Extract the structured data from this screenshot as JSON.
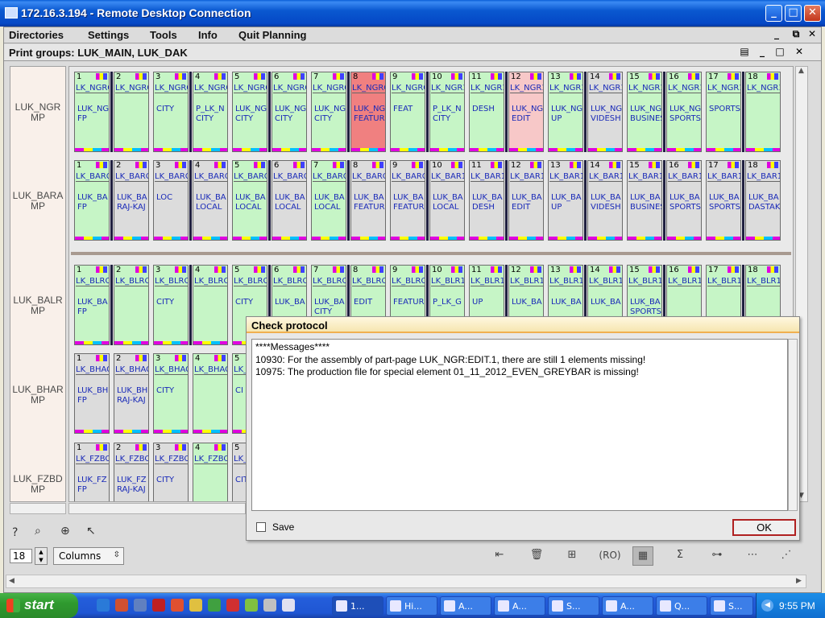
{
  "window": {
    "title": "172.16.3.194 - Remote Desktop Connection",
    "min_label": "_",
    "max_label": "□",
    "close_label": "✕"
  },
  "menu": {
    "items": [
      "Directories",
      "Settings",
      "Tools",
      "Info",
      "Quit Planning"
    ],
    "mdi_min": "_",
    "mdi_restore": "⧉",
    "mdi_close": "✕"
  },
  "print_groups": {
    "label": "Print groups: LUK_MAIN, LUK_DAK",
    "min": "_",
    "restore": "□",
    "close": "✕"
  },
  "row_labels": [
    "LUK_NGR MP",
    "LUK_BARA MP",
    "LUK_BALR MP",
    "LUK_BHAR MP",
    "LUK_FZBD MP"
  ],
  "rows": [
    {
      "prefix": "LK_NGR",
      "pages": [
        {
          "n": "1",
          "nm": "LK_NGRO",
          "sec": "LUK_NG\nFP",
          "c": "green"
        },
        {
          "n": "2",
          "nm": "LK_NGRO",
          "sec": "",
          "c": "green"
        },
        {
          "n": "3",
          "nm": "LK_NGRO",
          "sec": "CITY",
          "c": "green"
        },
        {
          "n": "4",
          "nm": "LK_NGRO",
          "sec": "P_LK_N\nCITY",
          "c": "green"
        },
        {
          "n": "5",
          "nm": "LK_NGRO",
          "sec": "LUK_NG\nCITY",
          "c": "green"
        },
        {
          "n": "6",
          "nm": "LK_NGRO",
          "sec": "LUK_NG\nCITY",
          "c": "green"
        },
        {
          "n": "7",
          "nm": "LK_NGRO",
          "sec": "LUK_NG\nCITY",
          "c": "green"
        },
        {
          "n": "8",
          "nm": "LK_NGRO",
          "sec": "LUK_NG\nFEATUR",
          "c": "red"
        },
        {
          "n": "9",
          "nm": "LK_NGRO",
          "sec": "FEAT",
          "c": "green"
        },
        {
          "n": "10",
          "nm": "LK_NGR1",
          "sec": "P_LK_N\nCITY",
          "c": "green"
        },
        {
          "n": "11",
          "nm": "LK_NGR1",
          "sec": "DESH",
          "c": "green"
        },
        {
          "n": "12",
          "nm": "LK_NGR1",
          "sec": "LUK_NG\nEDIT",
          "c": "pink"
        },
        {
          "n": "13",
          "nm": "LK_NGR1",
          "sec": "LUK_NG\nUP",
          "c": "green"
        },
        {
          "n": "14",
          "nm": "LK_NGR1",
          "sec": "LUK_NG\nVIDESH",
          "c": "grey"
        },
        {
          "n": "15",
          "nm": "LK_NGR1",
          "sec": "LUK_NG\nBUSINES",
          "c": "green"
        },
        {
          "n": "16",
          "nm": "LK_NGR1",
          "sec": "LUK_NG\nSPORTS",
          "c": "green"
        },
        {
          "n": "17",
          "nm": "LK_NGR1",
          "sec": "SPORTS",
          "c": "green"
        },
        {
          "n": "18",
          "nm": "LK_NGR1",
          "sec": "",
          "c": "green"
        }
      ]
    },
    {
      "pages": [
        {
          "n": "1",
          "nm": "LK_BARO",
          "sec": "LUK_BA\nFP",
          "c": "green"
        },
        {
          "n": "2",
          "nm": "LK_BARO",
          "sec": "LUK_BA\nRAJ-KAJ",
          "c": "grey"
        },
        {
          "n": "3",
          "nm": "LK_BARO",
          "sec": "LOC",
          "c": "grey"
        },
        {
          "n": "4",
          "nm": "LK_BARO",
          "sec": "LUK_BA\nLOCAL",
          "c": "grey"
        },
        {
          "n": "5",
          "nm": "LK_BARO",
          "sec": "LUK_BA\nLOCAL",
          "c": "green"
        },
        {
          "n": "6",
          "nm": "LK_BARO",
          "sec": "LUK_BA\nLOCAL",
          "c": "grey"
        },
        {
          "n": "7",
          "nm": "LK_BARO",
          "sec": "LUK_BA\nLOCAL",
          "c": "green"
        },
        {
          "n": "8",
          "nm": "LK_BARO",
          "sec": "LUK_BA\nFEATUR",
          "c": "grey"
        },
        {
          "n": "9",
          "nm": "LK_BARO",
          "sec": "LUK_BA\nFEATUR",
          "c": "grey"
        },
        {
          "n": "10",
          "nm": "LK_BAR1",
          "sec": "LUK_BA\nLOCAL",
          "c": "grey"
        },
        {
          "n": "11",
          "nm": "LK_BAR1",
          "sec": "LUK_BA\nDESH",
          "c": "grey"
        },
        {
          "n": "12",
          "nm": "LK_BAR1",
          "sec": "LUK_BA\nEDIT",
          "c": "grey"
        },
        {
          "n": "13",
          "nm": "LK_BAR1",
          "sec": "LUK_BA\nUP",
          "c": "grey"
        },
        {
          "n": "14",
          "nm": "LK_BAR1",
          "sec": "LUK_BA\nVIDESH",
          "c": "grey"
        },
        {
          "n": "15",
          "nm": "LK_BAR1",
          "sec": "LUK_BA\nBUSINES",
          "c": "grey"
        },
        {
          "n": "16",
          "nm": "LK_BAR1",
          "sec": "LUK_BA\nSPORTS",
          "c": "grey"
        },
        {
          "n": "17",
          "nm": "LK_BAR1",
          "sec": "LUK_BA\nSPORTS",
          "c": "grey"
        },
        {
          "n": "18",
          "nm": "LK_BAR1",
          "sec": "LUK_BA\nDASTAK",
          "c": "grey"
        }
      ]
    },
    {
      "pages": [
        {
          "n": "1",
          "nm": "LK_BLRO",
          "sec": "LUK_BA\nFP",
          "c": "green"
        },
        {
          "n": "2",
          "nm": "LK_BLRO",
          "sec": "",
          "c": "green"
        },
        {
          "n": "3",
          "nm": "LK_BLRO",
          "sec": "CITY",
          "c": "green"
        },
        {
          "n": "4",
          "nm": "LK_BLRO",
          "sec": "",
          "c": "green"
        },
        {
          "n": "5",
          "nm": "LK_BLRO",
          "sec": "CITY",
          "c": "green"
        },
        {
          "n": "6",
          "nm": "LK_BLRO",
          "sec": "LUK_BA",
          "c": "green"
        },
        {
          "n": "7",
          "nm": "LK_BLRO",
          "sec": "LUK_BA\nCITY",
          "c": "green"
        },
        {
          "n": "8",
          "nm": "LK_BLRO",
          "sec": "EDIT",
          "c": "green"
        },
        {
          "n": "9",
          "nm": "LK_BLRO",
          "sec": "FEATUR",
          "c": "green"
        },
        {
          "n": "10",
          "nm": "LK_BLR1",
          "sec": "P_LK_G",
          "c": "green"
        },
        {
          "n": "11",
          "nm": "LK_BLR1",
          "sec": "UP",
          "c": "green"
        },
        {
          "n": "12",
          "nm": "LK_BLR1",
          "sec": "LUK_BA",
          "c": "green"
        },
        {
          "n": "13",
          "nm": "LK_BLR1",
          "sec": "LUK_BA",
          "c": "green"
        },
        {
          "n": "14",
          "nm": "LK_BLR1",
          "sec": "LUK_BA",
          "c": "green"
        },
        {
          "n": "15",
          "nm": "LK_BLR1",
          "sec": "LUK_BA\nSPORTS",
          "c": "green"
        },
        {
          "n": "16",
          "nm": "LK_BLR1",
          "sec": "",
          "c": "green"
        },
        {
          "n": "17",
          "nm": "LK_BLR1",
          "sec": "",
          "c": "green"
        },
        {
          "n": "18",
          "nm": "LK_BLR1",
          "sec": "",
          "c": "green"
        }
      ]
    },
    {
      "pages": [
        {
          "n": "1",
          "nm": "LK_BHAO",
          "sec": "LUK_BH\nFP",
          "c": "grey"
        },
        {
          "n": "2",
          "nm": "LK_BHAO",
          "sec": "LUK_BH\nRAJ-KAJ",
          "c": "grey"
        },
        {
          "n": "3",
          "nm": "LK_BHAO",
          "sec": "CITY",
          "c": "green"
        },
        {
          "n": "4",
          "nm": "LK_BHAO",
          "sec": "",
          "c": "green"
        },
        {
          "n": "5",
          "nm": "LK_BHAO",
          "sec": "CI",
          "c": "green"
        }
      ]
    },
    {
      "pages": [
        {
          "n": "1",
          "nm": "LK_FZBO",
          "sec": "LUK_FZ\nFP",
          "c": "grey"
        },
        {
          "n": "2",
          "nm": "LK_FZBO",
          "sec": "LUK_FZ\nRAJ-KAJ",
          "c": "grey"
        },
        {
          "n": "3",
          "nm": "LK_FZBO",
          "sec": "CITY",
          "c": "grey"
        },
        {
          "n": "4",
          "nm": "LK_FZBO",
          "sec": "",
          "c": "green"
        },
        {
          "n": "5",
          "nm": "LK_FZBO",
          "sec": "CIT",
          "c": "grey"
        }
      ]
    }
  ],
  "toolbar": {
    "help": "?",
    "zoom_page": "⌕",
    "zoom_in": "⊕",
    "pointer": "↖",
    "columns_value": "18",
    "columns_select": "Columns",
    "ro_label": "(RO)"
  },
  "dialog": {
    "title": "Check protocol",
    "lines": [
      "****Messages****",
      "10930: For the assembly of part-page LUK_NGR:EDIT.1, there are still 1 elements missing!",
      "10975: The production file for special element 01_11_2012_EVEN_GREYBAR is missing!"
    ],
    "save_label": "Save",
    "ok_label": "OK"
  },
  "taskbar": {
    "start_label": "start",
    "tasks": [
      "1...",
      "Hi...",
      "A...",
      "A...",
      "S...",
      "A...",
      "Q...",
      "S..."
    ],
    "clock": "9:55 PM"
  },
  "colors": {
    "page_green": "#c6f5c6",
    "page_grey": "#dcdcdc",
    "page_red": "#f08080",
    "page_pink": "#f7c8c8",
    "page_text": "#1a2ab8"
  }
}
